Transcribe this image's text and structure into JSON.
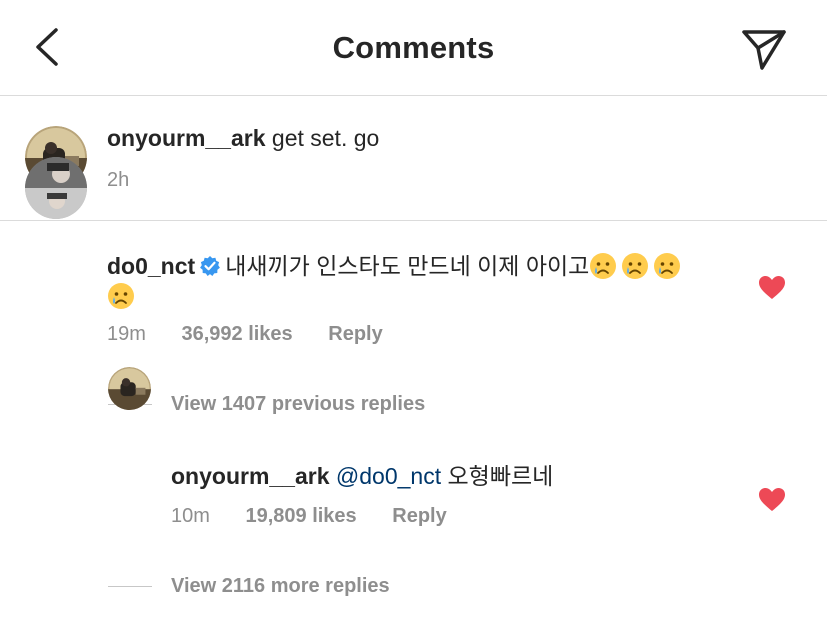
{
  "header": {
    "title": "Comments",
    "back_icon": "chevron-left-icon",
    "send_icon": "paper-plane-icon"
  },
  "caption": {
    "username": "onyourm__ark",
    "text": "get set. go",
    "time": "2h"
  },
  "comment": {
    "username": "do0_nct",
    "text": "내새끼가 인스타도 만드네 이제 아이고",
    "emoji": "crying-face-emoji",
    "time": "19m",
    "likes": "36,992 likes",
    "reply_label": "Reply",
    "liked": true
  },
  "view_previous": "View 1407 previous replies",
  "reply": {
    "username": "onyourm__ark",
    "mention": "@do0_nct",
    "text": "오형빠르네",
    "time": "10m",
    "likes": "19,809 likes",
    "reply_label": "Reply",
    "liked": true
  },
  "view_more": "View 2116 more replies",
  "colors": {
    "heart": "#ed4956",
    "verified": "#3897f0",
    "mention": "#00376b",
    "muted": "#8e8e8e"
  }
}
